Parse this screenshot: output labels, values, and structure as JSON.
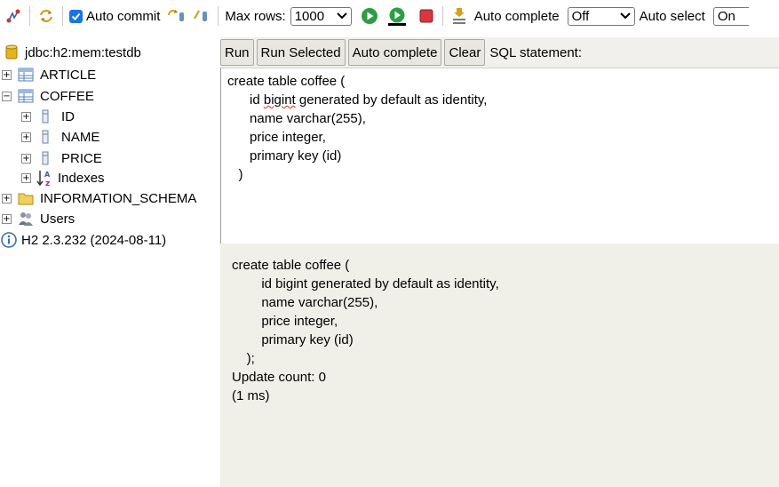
{
  "toolbar": {
    "icons": [
      "disconnect-icon",
      "refresh-icon",
      "commit-icon",
      "rollback-icon",
      "run-icon",
      "run-selected-icon",
      "stop-icon",
      "history-icon"
    ],
    "auto_commit_label": "Auto commit",
    "auto_commit_checked": true,
    "max_rows_label": "Max rows:",
    "max_rows_value": "1000",
    "auto_complete_label": "Auto complete",
    "auto_complete_value": "Off",
    "auto_select_label": "Auto select",
    "auto_select_value": "On"
  },
  "tree": {
    "connection": "jdbc:h2:mem:testdb",
    "nodes": [
      {
        "label": "ARTICLE",
        "type": "table",
        "toggle": "+"
      },
      {
        "label": "COFFEE",
        "type": "table",
        "toggle": "−"
      },
      {
        "label": "ID",
        "type": "column",
        "toggle": "+"
      },
      {
        "label": "NAME",
        "type": "column",
        "toggle": "+"
      },
      {
        "label": "PRICE",
        "type": "column",
        "toggle": "+"
      },
      {
        "label": "Indexes",
        "type": "indexes",
        "toggle": "+"
      },
      {
        "label": "INFORMATION_SCHEMA",
        "type": "folder",
        "toggle": "+"
      },
      {
        "label": "Users",
        "type": "users",
        "toggle": "+"
      }
    ],
    "version": "H2 2.3.232 (2024-08-11)"
  },
  "buttons": {
    "run": "Run",
    "run_selected": "Run Selected",
    "auto_complete": "Auto complete",
    "clear": "Clear",
    "sql_label": "SQL statement:"
  },
  "editor": {
    "line1": "create table coffee (",
    "line2_pre": "      id ",
    "line2_misspelled": "bigint",
    "line2_post": " generated by default as identity,",
    "line3": "      name varchar(255),",
    "line4": "      price integer,",
    "line5": "      primary key (id)",
    "line6": "   )"
  },
  "result": {
    "lines": [
      "create table coffee (",
      "        id bigint generated by default as identity,",
      "        name varchar(255),",
      "        price integer,",
      "        primary key (id)",
      "    );",
      "Update count: 0",
      "(1 ms)"
    ]
  },
  "colors": {
    "result_bg": "#f0efe8",
    "button_bar_bg": "#f1f0ec",
    "checkbox_accent": "#1a73e8",
    "stop_red": "#d9363e",
    "run_green": "#2e9e44"
  }
}
